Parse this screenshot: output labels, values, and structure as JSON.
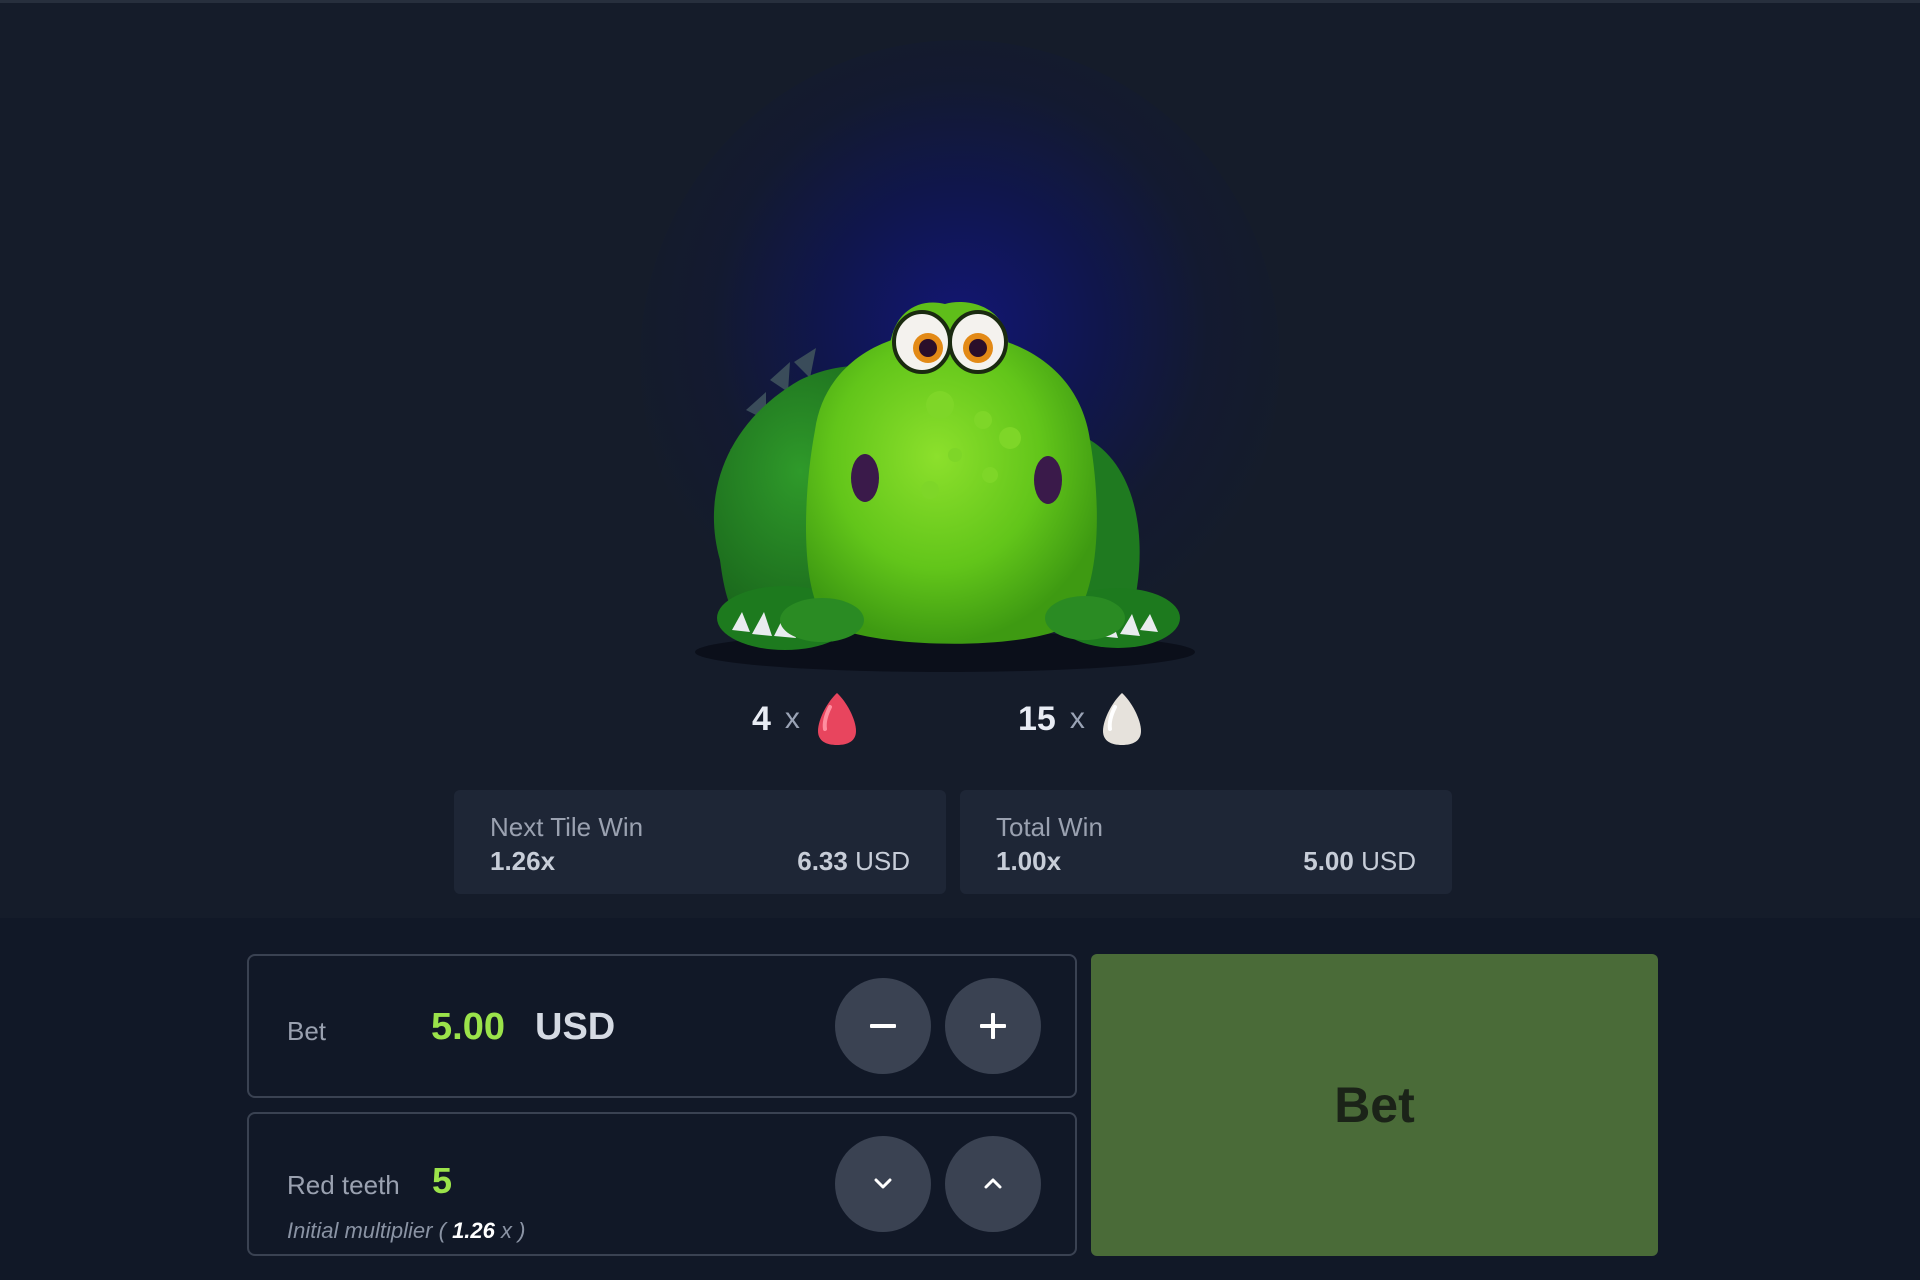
{
  "counts": {
    "red_teeth": "4",
    "white_teeth": "15",
    "times": "x"
  },
  "next_tile": {
    "title": "Next Tile Win",
    "multiplier": "1.26x",
    "amount": "6.33",
    "currency": "USD"
  },
  "total_win": {
    "title": "Total Win",
    "multiplier": "1.00x",
    "amount": "5.00",
    "currency": "USD"
  },
  "bet_panel": {
    "label": "Bet",
    "value": "5.00",
    "currency": "USD",
    "decrease_icon": "minus-icon",
    "increase_icon": "plus-icon"
  },
  "teeth_panel": {
    "label": "Red teeth",
    "value": "5",
    "sub_prefix": "Initial multiplier (",
    "sub_value": "1.26",
    "sub_suffix": "x )",
    "decrease_icon": "chevron-down-icon",
    "increase_icon": "chevron-up-icon"
  },
  "bet_button": {
    "label": "Bet"
  },
  "colors": {
    "accent_green": "#9be34a",
    "bet_button_bg": "#4a6b38",
    "red_tooth": "#e8455e",
    "white_tooth": "#e6e2dc",
    "dino_green": "#6fd021"
  }
}
